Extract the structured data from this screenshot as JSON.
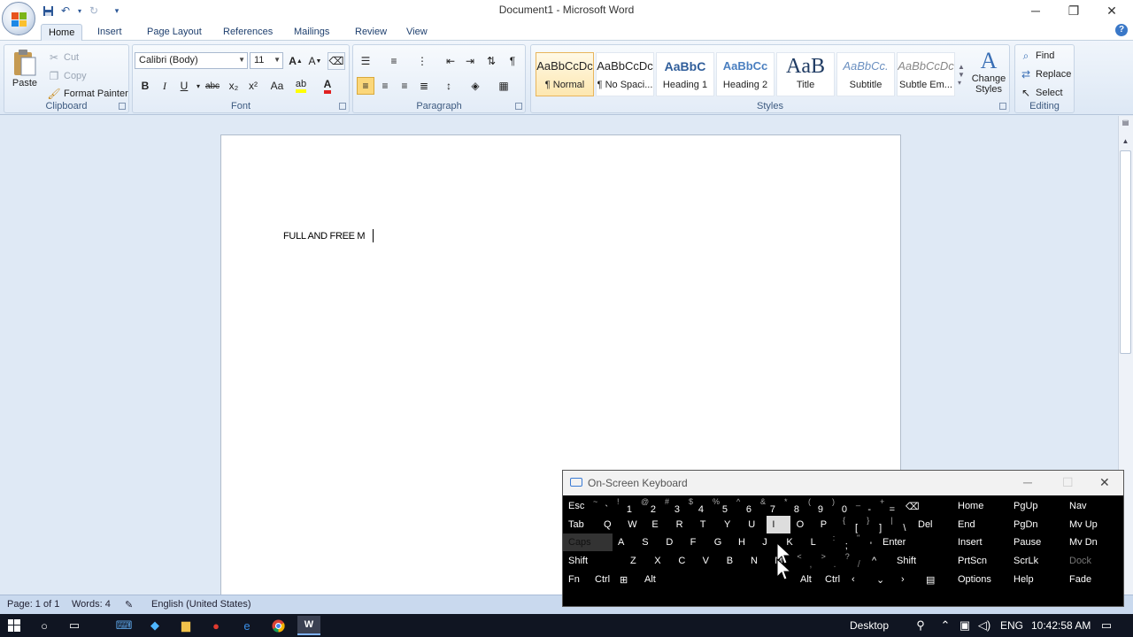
{
  "window": {
    "title": "Document1 - Microsoft Word"
  },
  "qat": {
    "icons": [
      "save-icon",
      "undo-icon",
      "redo-icon",
      "customize-icon"
    ]
  },
  "tabs": [
    "Home",
    "Insert",
    "Page Layout",
    "References",
    "Mailings",
    "Review",
    "View"
  ],
  "clipboard": {
    "paste": "Paste",
    "cut": "Cut",
    "copy": "Copy",
    "format_painter": "Format Painter",
    "label": "Clipboard"
  },
  "font": {
    "name": "Calibri (Body)",
    "size": "11",
    "label": "Font",
    "buttons": [
      "B",
      "I",
      "U",
      "abc",
      "x₂",
      "x²",
      "Aa"
    ],
    "highlight_color": "#ffff00",
    "font_color": "#e02020"
  },
  "paragraph": {
    "label": "Paragraph"
  },
  "styles": {
    "label": "Styles",
    "items": [
      {
        "preview": "AaBbCcDc",
        "name": "¶ Normal"
      },
      {
        "preview": "AaBbCcDc",
        "name": "¶ No Spaci..."
      },
      {
        "preview": "AaBbC",
        "name": "Heading 1"
      },
      {
        "preview": "AaBbCc",
        "name": "Heading 2"
      },
      {
        "preview": "AaB",
        "name": "Title"
      },
      {
        "preview": "AaBbCc.",
        "name": "Subtitle"
      },
      {
        "preview": "AaBbCcDc",
        "name": "Subtle Em..."
      }
    ],
    "change": "Change Styles"
  },
  "editing": {
    "find": "Find",
    "replace": "Replace",
    "select": "Select",
    "label": "Editing"
  },
  "document": {
    "text": "FULL AND FREE M"
  },
  "status": {
    "page": "Page: 1 of 1",
    "words": "Words: 4",
    "language": "English (United States)"
  },
  "osk": {
    "title": "On-Screen Keyboard",
    "row1": [
      "Esc",
      "~ `",
      "! 1",
      "@ 2",
      "# 3",
      "$ 4",
      "% 5",
      "^ 6",
      "& 7",
      "* 8",
      "( 9",
      ") 0",
      "_ -",
      "+ ="
    ],
    "row2": [
      "Tab",
      "Q",
      "W",
      "E",
      "R",
      "T",
      "Y",
      "U",
      "I",
      "O",
      "P",
      "{ [",
      "} ]",
      "| \\",
      "Del"
    ],
    "row3": [
      "Caps",
      "A",
      "S",
      "D",
      "F",
      "G",
      "H",
      "J",
      "K",
      "L",
      ": ;",
      "\" '",
      "Enter"
    ],
    "row4": [
      "Shift",
      "Z",
      "X",
      "C",
      "V",
      "B",
      "N",
      "M",
      "< ,",
      "> .",
      "? /",
      "^",
      "Shift"
    ],
    "row5": [
      "Fn",
      "Ctrl",
      "Win",
      "Alt",
      "Alt",
      "Ctrl",
      "<",
      "v",
      ">",
      "menu"
    ],
    "nav": [
      [
        "Home",
        "PgUp",
        "Nav"
      ],
      [
        "End",
        "PgDn",
        "Mv Up"
      ],
      [
        "Insert",
        "Pause",
        "Mv Dn"
      ],
      [
        "PrtScn",
        "ScrLk",
        "Dock"
      ],
      [
        "Options",
        "Help",
        "Fade"
      ]
    ]
  },
  "taskbar": {
    "desktop": "Desktop",
    "lang": "ENG",
    "time": "10:42:58 AM"
  }
}
